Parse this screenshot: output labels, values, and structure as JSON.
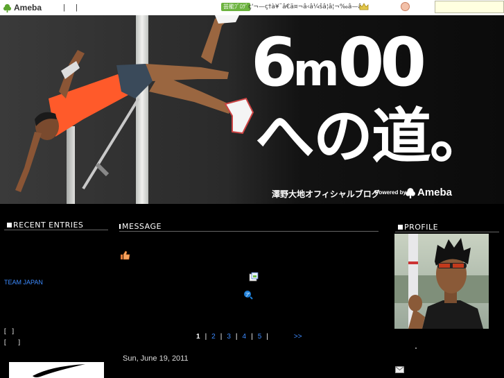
{
  "topbar": {
    "logo_text": "Ameba",
    "separators": [
      "|",
      "|"
    ],
    "promo_badge": "芸能ﾌﾞﾛｸﾞ",
    "promo_text": "ç'¬—ç†à¥˜â€ä¤¬â‹â¼šâ¦â¦¬‰â—â..",
    "icons": [
      "leaf-icon",
      "crown-icon",
      "pig-icon"
    ]
  },
  "header": {
    "title_big": "6m00",
    "title_jp": "への道。",
    "subtitle": "澤野大地オフィシャルブログ",
    "powered_by": "Powered by",
    "brand": "Ameba"
  },
  "sidebar_left": {
    "title": "RECENT ENTRIES",
    "link": "TEAM JAPAN",
    "brackets": [
      "[　]",
      "[　　]"
    ]
  },
  "main": {
    "title": "MESSAGE",
    "pagination": {
      "current": "1",
      "pages": [
        "2",
        "3",
        "4",
        "5"
      ],
      "next": ">>"
    },
    "entry_date": "Sun, June 19, 2011"
  },
  "sidebar_right": {
    "title": "PROFILE"
  }
}
